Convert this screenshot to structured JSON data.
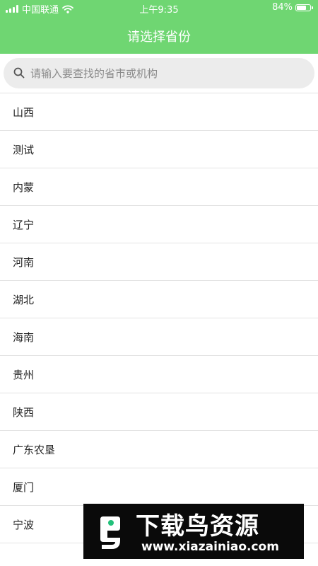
{
  "status_bar": {
    "carrier": "中国联通",
    "time": "上午9:35",
    "battery_percent": "84%",
    "battery_level": 0.84
  },
  "header": {
    "title": "请选择省份"
  },
  "search": {
    "placeholder": "请输入要查找的省市或机构",
    "value": ""
  },
  "provinces": [
    {
      "label": "山西"
    },
    {
      "label": "测试"
    },
    {
      "label": "内蒙"
    },
    {
      "label": "辽宁"
    },
    {
      "label": "河南"
    },
    {
      "label": "湖北"
    },
    {
      "label": "海南"
    },
    {
      "label": "贵州"
    },
    {
      "label": "陕西"
    },
    {
      "label": "广东农垦"
    },
    {
      "label": "厦门"
    },
    {
      "label": "宁波"
    }
  ],
  "watermark": {
    "title": "下载鸟资源",
    "url": "www.xiazainiao.com"
  },
  "colors": {
    "accent": "#6fd672",
    "divider": "#e3e3e3",
    "search_bg": "#ececec"
  },
  "icons": {
    "search": "search-icon",
    "wifi": "wifi-icon",
    "signal": "signal-icon",
    "battery": "battery-icon"
  }
}
